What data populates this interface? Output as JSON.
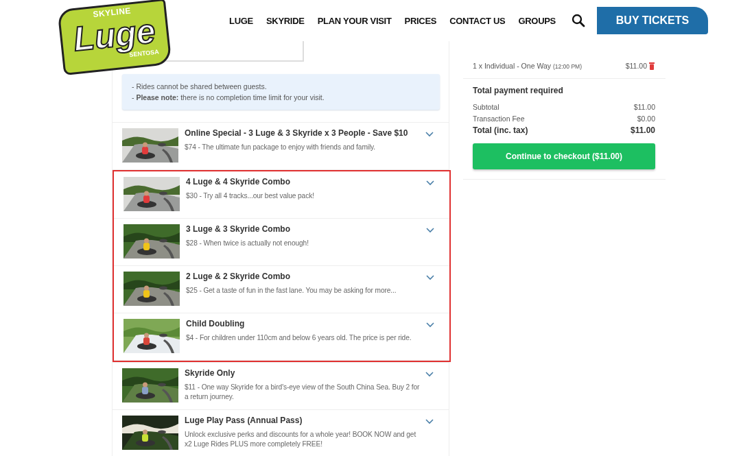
{
  "logo": {
    "top": "SKYLINE",
    "main": "Luge",
    "bottom": "SENTOSA"
  },
  "nav": [
    {
      "label": "LUGE"
    },
    {
      "label": "SKYRIDE"
    },
    {
      "label": "PLAN YOUR VISIT"
    },
    {
      "label": "PRICES"
    },
    {
      "label": "CONTACT US"
    },
    {
      "label": "GROUPS"
    }
  ],
  "buy_button": "BUY TICKETS",
  "notice": [
    "- Rides cannot be shared between guests.",
    "- **Please note:** there is no completion time limit for your visit."
  ],
  "products": [
    {
      "title": "Online Special - 3 Luge & 3 Skyride x 3 People - Save $10",
      "description": "$74 - The ultimate fun package to enjoy with friends and family.",
      "highlighted": false
    },
    {
      "title": "4 Luge & 4 Skyride Combo",
      "description": "$30 - Try all 4 tracks...our best value pack!",
      "highlighted": true
    },
    {
      "title": "3 Luge & 3 Skyride Combo",
      "description": "$28 - When twice is actually not enough!",
      "highlighted": true
    },
    {
      "title": "2 Luge & 2 Skyride Combo",
      "description": "$25 - Get a taste of fun in the fast lane. You may be asking for more...",
      "highlighted": true
    },
    {
      "title": "Child Doubling",
      "description": "$4 - For children under 110cm and below 6 years old. The price is per ride.",
      "highlighted": true
    },
    {
      "title": "Skyride Only",
      "description": "$11 - One way Skyride for a bird's-eye view of the South China Sea. Buy 2 for a return journey.",
      "highlighted": false
    },
    {
      "title": "Luge Play Pass (Annual Pass)",
      "description": "Unlock exclusive perks and discounts for a whole year! BOOK NOW and get x2 Luge Rides PLUS more completely FREE!",
      "highlighted": false
    }
  ],
  "cart": {
    "item": {
      "label": "1 x Individual - One Way",
      "time": "(12:00 PM)",
      "price": "$11.00"
    },
    "total_heading": "Total payment required",
    "lines": [
      {
        "label": "Subtotal",
        "value": "$11.00",
        "kind": "plain"
      },
      {
        "label": "Transaction Fee",
        "value": "$0.00",
        "kind": "plain"
      },
      {
        "label": "Total (inc. tax)",
        "value": "$11.00",
        "kind": "total"
      }
    ],
    "checkout_button": "Continue to checkout ($11.00)"
  }
}
